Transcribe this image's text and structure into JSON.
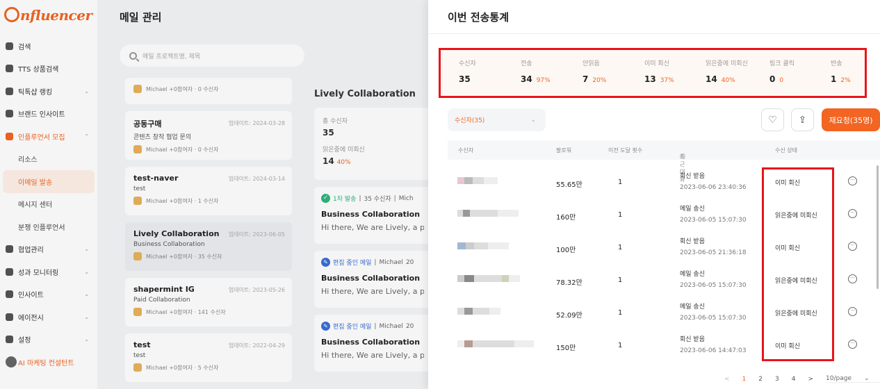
{
  "app": {
    "logo": "nfluencer",
    "page_title": "메일 관리",
    "search_placeholder": "메일 프로젝트명, 제목"
  },
  "sidebar": {
    "items": [
      {
        "label": "검색",
        "icon": "search-icon"
      },
      {
        "label": "TTS 상품검색",
        "icon": "bag-icon"
      },
      {
        "label": "틱톡샵 랭킹",
        "icon": "bar-chart-icon"
      },
      {
        "label": "브랜드 인사이트",
        "icon": "brand-icon"
      },
      {
        "label": "인플루언서 모집",
        "icon": "users-icon"
      },
      {
        "label": "리소스",
        "icon": ""
      },
      {
        "label": "이메일 발송",
        "icon": ""
      },
      {
        "label": "메시지 센터",
        "icon": ""
      },
      {
        "label": "분쟁 인플루언서",
        "icon": ""
      },
      {
        "label": "협업관리",
        "icon": "document-icon"
      },
      {
        "label": "성과 모니터링",
        "icon": "monitor-icon"
      },
      {
        "label": "인사이트",
        "icon": "insight-icon"
      },
      {
        "label": "에이전시",
        "icon": "agency-icon"
      },
      {
        "label": "설정",
        "icon": "gear-icon"
      }
    ],
    "ai_label": "AI 마케팅 컨설턴트"
  },
  "projects": [
    {
      "name": "",
      "date": "",
      "sub": "",
      "author": "Michael",
      "meta": "+0참여자 · 0 수신자"
    },
    {
      "name": "공동구매",
      "date": "업데이트: 2024-03-28",
      "sub": "콘텐츠 창작 협업 문의",
      "author": "Michael",
      "meta": "+0참여자 · 0 수신자"
    },
    {
      "name": "test-naver",
      "date": "업데이트: 2024-03-14",
      "sub": "test",
      "author": "Michael",
      "meta": "+0참여자 · 1 수신자"
    },
    {
      "name": "Lively Collaboration",
      "date": "업데이트: 2023-06-05",
      "sub": "Business Collaboration",
      "author": "Michael",
      "meta": "+0참여자 · 35 수신자"
    },
    {
      "name": "shapermint IG",
      "date": "업데이트: 2023-05-26",
      "sub": "Paid Collaboration",
      "author": "Michael",
      "meta": "+0참여자 · 141 수신자"
    },
    {
      "name": "test",
      "date": "업데이트: 2022-04-29",
      "sub": "test",
      "author": "Michael",
      "meta": "+0참여자 · 5 수신자"
    }
  ],
  "detail": {
    "title": "Lively Collaboration",
    "total_label": "총 수신자",
    "total_value": "35",
    "read_label": "읽은중에 미회신",
    "read_value": "14",
    "read_pct": "40%",
    "mails": [
      {
        "tag": "1차 발송",
        "meta": "35 수신자",
        "author": "Mich",
        "title": "Business Collaboration",
        "body": "Hi there, We are Lively, a prom"
      },
      {
        "tag": "편집 중인 메일",
        "meta": "Michael",
        "author": "20",
        "title": "Business Collaboration",
        "body": "Hi there, We are Lively, a pror"
      },
      {
        "tag": "편집 중인 메일",
        "meta": "Michael",
        "author": "20",
        "title": "Business Collaboration",
        "body": "Hi there, We are Lively, a pror"
      }
    ]
  },
  "drawer": {
    "title": "이번 전송통계",
    "stats": [
      {
        "label": "수신자",
        "value": "35",
        "pct": ""
      },
      {
        "label": "전송",
        "value": "34",
        "pct": "97%"
      },
      {
        "label": "안읽음",
        "value": "7",
        "pct": "20%"
      },
      {
        "label": "이미 회신",
        "value": "13",
        "pct": "37%"
      },
      {
        "label": "읽은중에 미회신",
        "value": "14",
        "pct": "40%"
      },
      {
        "label": "링크 클릭",
        "value": "0",
        "pct": "0"
      },
      {
        "label": "반송",
        "value": "1",
        "pct": "2%"
      }
    ],
    "filter_label": "수신자(35)",
    "resend_label": "재요청(35명)",
    "columns": [
      "수신자",
      "팔로워",
      "이전 도달 횟수",
      "최근 대화",
      "수신 상태"
    ],
    "rows": [
      {
        "followers": "55.65만",
        "count": "1",
        "event": "회신 받음",
        "time": "2023-06-06 23:40:36",
        "status": "이미 회신"
      },
      {
        "followers": "160만",
        "count": "1",
        "event": "메일 송신",
        "time": "2023-06-05 15:07:30",
        "status": "읽은중에 미회신"
      },
      {
        "followers": "100만",
        "count": "1",
        "event": "회신 받음",
        "time": "2023-06-05 21:36:18",
        "status": "이미 회신"
      },
      {
        "followers": "78.32만",
        "count": "1",
        "event": "메일 송신",
        "time": "2023-06-05 15:07:30",
        "status": "읽은중에 미회신"
      },
      {
        "followers": "52.09만",
        "count": "1",
        "event": "메일 송신",
        "time": "2023-06-05 15:07:30",
        "status": "읽은중에 미회신"
      },
      {
        "followers": "150만",
        "count": "1",
        "event": "회신 받음",
        "time": "2023-06-06 14:47:03",
        "status": "이미 회신"
      }
    ],
    "pager": {
      "prev": "<",
      "pages": [
        "1",
        "2",
        "3",
        "4"
      ],
      "next": ">",
      "size": "10/page"
    }
  },
  "colors": {
    "accent": "#f26522",
    "highlight": "#e8141c"
  }
}
